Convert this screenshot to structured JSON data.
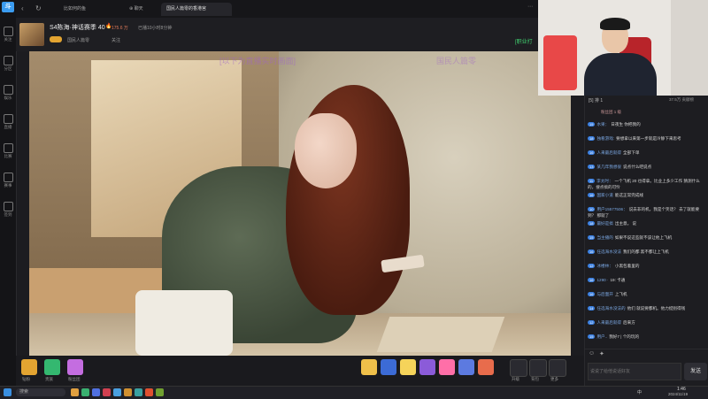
{
  "tabs": [
    {
      "label": "比如何的鱼"
    },
    {
      "label": "聊天"
    },
    {
      "label": "国民人篇零的香港宫"
    }
  ],
  "left_nav": [
    {
      "label": "关注",
      "icon": "heart-icon"
    },
    {
      "label": "分区",
      "icon": "grid-icon"
    },
    {
      "label": "娱乐",
      "icon": "star-icon"
    },
    {
      "label": "直播",
      "icon": "camera-icon"
    },
    {
      "label": "比赛",
      "icon": "trophy-icon"
    },
    {
      "label": "赛事",
      "icon": "cup-icon"
    },
    {
      "label": "签到",
      "icon": "check-icon"
    }
  ],
  "header": {
    "room_title": "S4陈海·神话赛季 40",
    "room_subtitle": "国民人篇零",
    "viewer_count": "175.6 万",
    "meta1": "已播10小时8分钟",
    "follow_label": "关注",
    "rank_label": "[职业打"
  },
  "video": {
    "watermark": "[以下为直播实时画面]",
    "watermark2": "国民人篇零"
  },
  "bottom": {
    "left_icons": [
      {
        "label": "钻粉",
        "color": "#e3a431",
        "icon": "crown-icon"
      },
      {
        "label": "贵族",
        "color": "#34b870",
        "icon": "medal-icon"
      },
      {
        "label": "粉丝团",
        "color": "#c46de0",
        "icon": "badge-icon"
      }
    ],
    "gifts": [
      {
        "color": "#f0c04a"
      },
      {
        "color": "#3c6bd6"
      },
      {
        "color": "#f5d35a"
      },
      {
        "color": "#8b5bd9"
      },
      {
        "color": "#ff6fa8"
      },
      {
        "color": "#5c7ae0"
      },
      {
        "color": "#e86c4c"
      }
    ],
    "right_buttons": [
      {
        "label": "升级"
      },
      {
        "label": "背包"
      },
      {
        "label": "更多"
      }
    ]
  },
  "chat": {
    "header_top": "[5]  排 1",
    "header_right": "37.5万 贡献榜",
    "pinned": "粉丝团 1 级",
    "messages": [
      {
        "level": "15",
        "user": "水果：",
        "text": "日夜生 你把我的",
        "color": "#3a7fe0"
      },
      {
        "level": "18",
        "user": "独看游戏:",
        "text": "要想拿以来第一步就是冷静下来思考",
        "color": "#3a7fe0"
      },
      {
        "level": "16",
        "user": "人来最后就得",
        "text": "全部下单",
        "color": "#3a7fe0"
      },
      {
        "level": "13",
        "user": "某几年我想很",
        "text": "说点什么吧说点",
        "color": "#3a7fe0"
      },
      {
        "level": "11",
        "user": "李太时：",
        "text": "一个飞机 20 也得拿。比业上多少工作 猜测什么的，搜点搞的可怜",
        "color": "#3a7fe0"
      },
      {
        "level": "16",
        "user": "国家小道",
        "text": "能这正常完成线",
        "color": "#3a7fe0"
      },
      {
        "level": "10",
        "user": "用户15577506：",
        "text": "说去非的机，我是个笑话？ 去了就能要到？ 那就了",
        "color": "#3a7fe0"
      },
      {
        "level": "18",
        "user": "最好是搞",
        "text": "出主意。 说",
        "color": "#3a7fe0"
      },
      {
        "level": "15",
        "user": "当主播的",
        "text": "如果不说这些就不该让他上飞机",
        "color": "#3a7fe0"
      },
      {
        "level": "16",
        "user": "任选海水没法",
        "text": "我们的都 黑不都让上飞机",
        "color": "#3a7fe0"
      },
      {
        "level": "12",
        "user": "冰楼林：",
        "text": "小黑包着里的",
        "color": "#3a7fe0"
      },
      {
        "level": "16",
        "user": "1290 ·",
        "text": "19: 卡通",
        "color": "#3a7fe0"
      },
      {
        "level": "16",
        "user": "与后面开",
        "text": "上飞机",
        "color": "#3a7fe0"
      },
      {
        "level": "14",
        "user": "任选海水没法的",
        "text": "他们 就说要都机。他力挺别得钱",
        "color": "#3a7fe0"
      },
      {
        "level": "12",
        "user": "人来最后就得",
        "text": "后来方",
        "color": "#3a7fe0"
      },
      {
        "level": "15",
        "user": "用户..",
        "text": "我好7 | 个的玩的",
        "color": "#3a7fe0"
      }
    ],
    "input_placeholder": "说说了给他说话好友",
    "send_label": "发送",
    "send_icon": "paper-plane-icon"
  },
  "taskbar": {
    "search_placeholder": "搜索",
    "time": "1:46",
    "date": "2024/11/19",
    "tray": "中"
  }
}
